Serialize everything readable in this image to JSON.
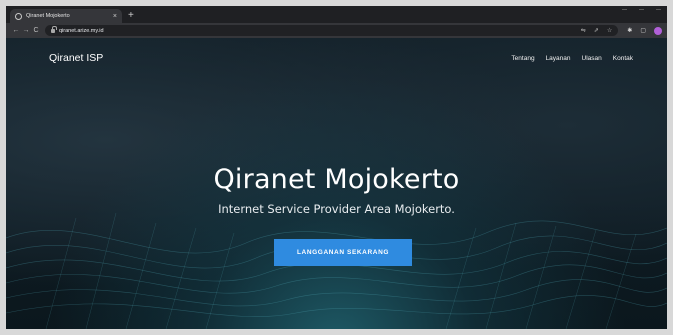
{
  "browser": {
    "tab_title": "Qiranet Mojokerto",
    "new_tab": "+",
    "tab_close": "×",
    "url": "qiranet.arize.my.id",
    "icons": [
      "back-icon",
      "forward-icon",
      "reload-icon",
      "lock-icon",
      "translate-icon",
      "share-icon",
      "star-icon",
      "extensions-icon",
      "side-panel-icon",
      "profile-icon"
    ],
    "profile_color": "#b160d8"
  },
  "site": {
    "logo": "Qiranet ISP",
    "nav": [
      "Tentang",
      "Layanan",
      "Ulasan",
      "Kontak"
    ],
    "hero_title": "Qiranet Mojokerto",
    "hero_subtitle": "Internet Service Provider Area Mojokerto.",
    "cta_label": "LANGGANAN SEKARANG",
    "accent_color": "#2f8be0"
  }
}
